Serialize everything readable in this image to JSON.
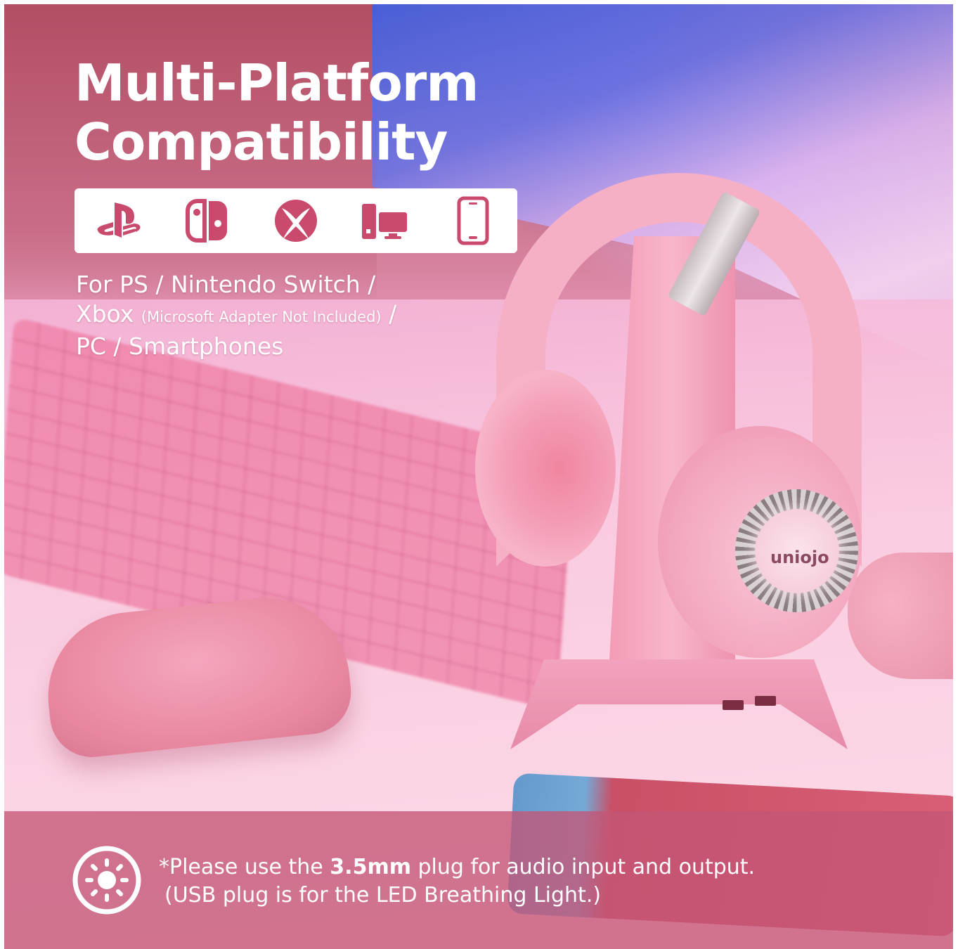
{
  "headline": {
    "line1": "Multi-Platform",
    "line2": "Compatibility"
  },
  "platform_icons": [
    "playstation-icon",
    "nintendo-switch-icon",
    "xbox-icon",
    "pc-icon",
    "smartphone-icon"
  ],
  "compatibility": {
    "line1": "For PS / Nintendo Switch /",
    "line2_main": "Xbox",
    "line2_note": "(Microsoft Adapter Not Included)",
    "line2_sep": " /",
    "line3": "PC / Smartphones"
  },
  "product_brand": "uniojo",
  "notice": {
    "prefix": "*Please use the ",
    "emphasis": "3.5mm",
    "suffix": " plug for audio input and output.",
    "line2": "(USB plug is for the LED Breathing Light.)"
  },
  "colors": {
    "accent_pink": "#c45676",
    "icon_color": "#c94a6c",
    "text_white": "#ffffff"
  }
}
